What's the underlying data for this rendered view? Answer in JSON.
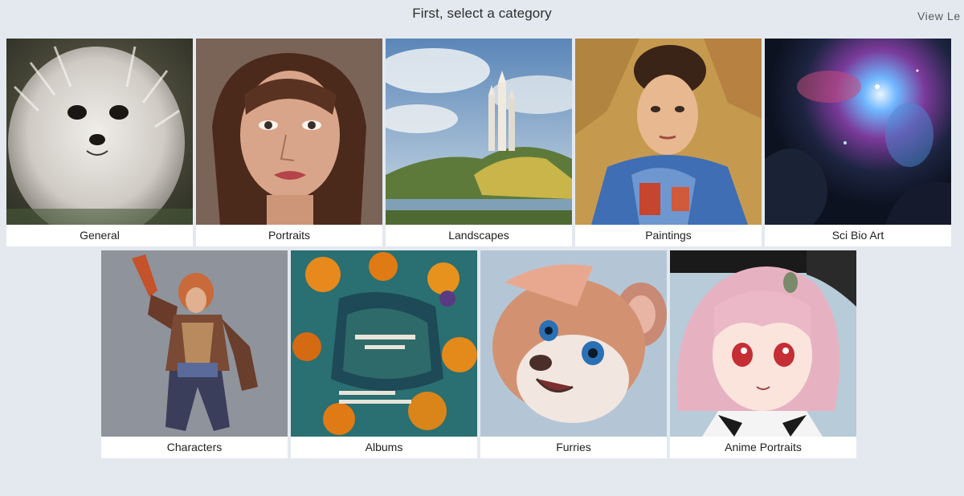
{
  "header": {
    "title": "First, select a category",
    "view_link": "View Le"
  },
  "categories": [
    {
      "label": "General",
      "icon": "fluffy-dog-image"
    },
    {
      "label": "Portraits",
      "icon": "woman-portrait-image"
    },
    {
      "label": "Landscapes",
      "icon": "castle-landscape-image"
    },
    {
      "label": "Paintings",
      "icon": "painted-portrait-image"
    },
    {
      "label": "Sci Bio Art",
      "icon": "nebula-image"
    },
    {
      "label": "Characters",
      "icon": "armored-character-image"
    },
    {
      "label": "Albums",
      "icon": "album-cover-image"
    },
    {
      "label": "Furries",
      "icon": "cartoon-animal-image"
    },
    {
      "label": "Anime Portraits",
      "icon": "anime-girl-image"
    }
  ],
  "colors": {
    "background": "#e4e9ef",
    "card": "#ffffff",
    "text": "#1f1f1f"
  }
}
